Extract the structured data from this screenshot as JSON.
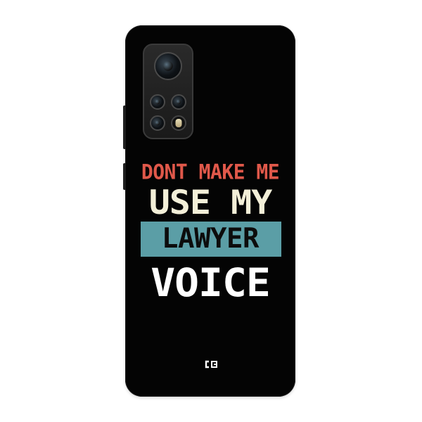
{
  "product": {
    "case_print": {
      "line1": "DONT MAKE ME",
      "line2": "USE MY",
      "line3": "LAWYER",
      "line4": "VOICE"
    },
    "brand_mark": "C",
    "colors": {
      "case_body": "#040404",
      "line1": "#e0584a",
      "line2": "#f3efd8",
      "band": "#5b9ea6",
      "line3": "#0c0c0c",
      "line4": "#ffffff"
    },
    "icons": [
      "camera-lens-icon",
      "flash-icon",
      "brand-logo-icon"
    ]
  }
}
